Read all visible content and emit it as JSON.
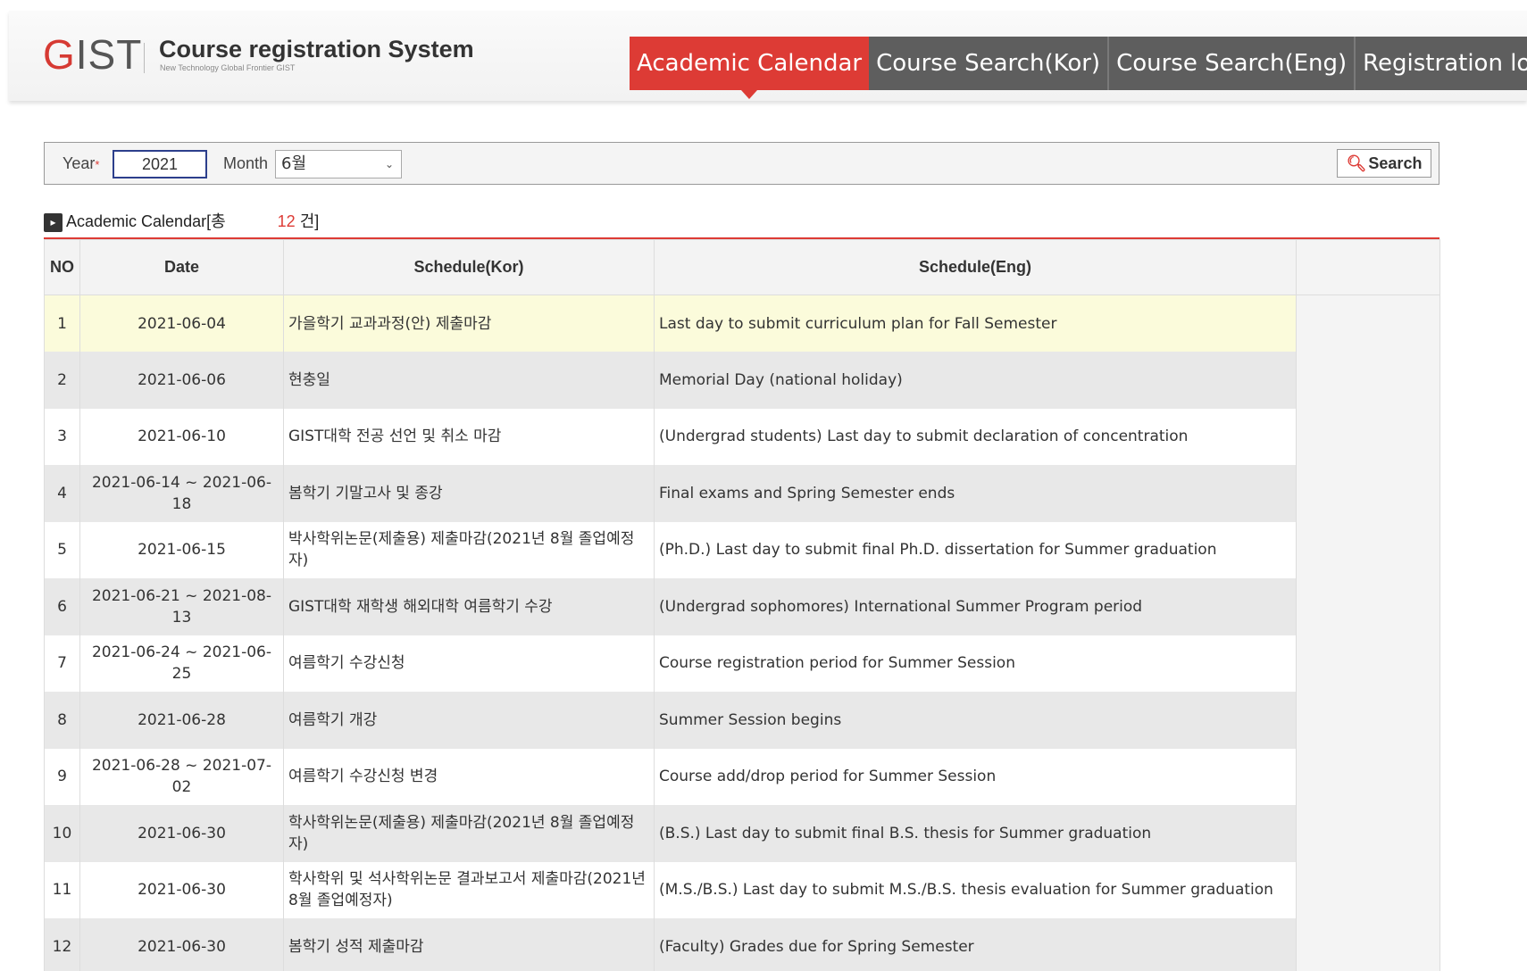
{
  "header": {
    "logo": "GIST",
    "title": "Course registration System",
    "subtitle": "New Technology Global Frontier GIST",
    "nav": [
      {
        "label": "Academic Calendar",
        "active": true
      },
      {
        "label": "Course Search(Kor)",
        "active": false
      },
      {
        "label": "Course Search(Eng)",
        "active": false
      },
      {
        "label": "Registration log-in",
        "active": false
      }
    ],
    "accent_color": "#dd3b35"
  },
  "search": {
    "year_label": "Year",
    "required_mark": "*",
    "year_value": "2021",
    "month_label": "Month",
    "month_value": "6월",
    "button_label": "Search",
    "button_icon": "search-icon"
  },
  "section": {
    "title": "Academic Calendar",
    "count_prefix": "[총",
    "count": "12",
    "count_suffix": "건]"
  },
  "table": {
    "columns": [
      "NO",
      "Date",
      "Schedule(Kor)",
      "Schedule(Eng)"
    ],
    "rows": [
      {
        "no": "1",
        "date": "2021-06-04",
        "kor": "가을학기 교과과정(안) 제출마감",
        "eng": "Last day to submit curriculum plan for Fall Semester"
      },
      {
        "no": "2",
        "date": "2021-06-06",
        "kor": "현충일",
        "eng": "Memorial Day (national holiday)"
      },
      {
        "no": "3",
        "date": "2021-06-10",
        "kor": "GIST대학 전공 선언 및 취소 마감",
        "eng": "(Undergrad students) Last day to submit declaration of concentration"
      },
      {
        "no": "4",
        "date": "2021-06-14 ~ 2021-06-18",
        "kor": "봄학기 기말고사 및 종강",
        "eng": "Final exams and Spring Semester ends"
      },
      {
        "no": "5",
        "date": "2021-06-15",
        "kor": "박사학위논문(제출용) 제출마감(2021년 8월 졸업예정자)",
        "eng": "(Ph.D.) Last day to submit final Ph.D. dissertation for Summer graduation"
      },
      {
        "no": "6",
        "date": "2021-06-21 ~ 2021-08-13",
        "kor": "GIST대학 재학생 해외대학 여름학기 수강",
        "eng": "(Undergrad sophomores) International Summer Program period"
      },
      {
        "no": "7",
        "date": "2021-06-24 ~ 2021-06-25",
        "kor": "여름학기 수강신청",
        "eng": "Course registration period for Summer Session"
      },
      {
        "no": "8",
        "date": "2021-06-28",
        "kor": "여름학기 개강",
        "eng": "Summer Session begins"
      },
      {
        "no": "9",
        "date": "2021-06-28 ~ 2021-07-02",
        "kor": "여름학기 수강신청 변경",
        "eng": "Course add/drop period for Summer Session"
      },
      {
        "no": "10",
        "date": "2021-06-30",
        "kor": "학사학위논문(제출용) 제출마감(2021년 8월 졸업예정자)",
        "eng": "(B.S.) Last day to submit final B.S. thesis for Summer graduation"
      },
      {
        "no": "11",
        "date": "2021-06-30",
        "kor": "학사학위 및 석사학위논문 결과보고서 제출마감(2021년 8월 졸업예정자)",
        "eng": "(M.S./B.S.) Last day to submit M.S./B.S. thesis evaluation for Summer graduation"
      },
      {
        "no": "12",
        "date": "2021-06-30",
        "kor": "봄학기 성적 제출마감",
        "eng": "(Faculty) Grades due for Spring Semester"
      }
    ]
  }
}
